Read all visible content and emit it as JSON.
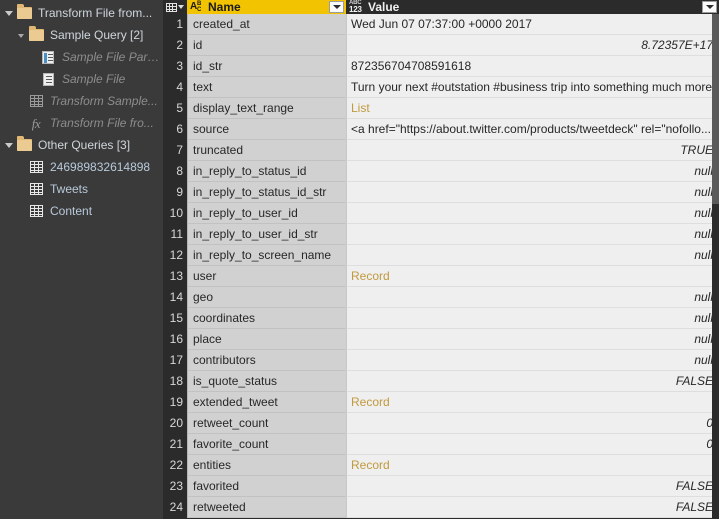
{
  "queries_pane": {
    "nodes": [
      {
        "label": "Transform File from...",
        "icon": "folder-icon",
        "depth": 0,
        "expandable": true,
        "style": "normal"
      },
      {
        "label": "Sample Query [2]",
        "icon": "folder-icon",
        "depth": 1,
        "expandable": true,
        "style": "normal"
      },
      {
        "label": "Sample File Para...",
        "icon": "parameter-icon",
        "depth": 2,
        "expandable": false,
        "style": "dim"
      },
      {
        "label": "Sample File",
        "icon": "binary-file-icon",
        "depth": 2,
        "expandable": false,
        "style": "dim"
      },
      {
        "label": "Transform Sample...",
        "icon": "table-icon",
        "depth": 1,
        "expandable": false,
        "style": "dim"
      },
      {
        "label": "Transform File fro...",
        "icon": "function-fx-icon",
        "depth": 1,
        "expandable": false,
        "style": "dim"
      },
      {
        "label": "Other Queries [3]",
        "icon": "folder-icon",
        "depth": 0,
        "expandable": true,
        "style": "normal"
      },
      {
        "label": "246989832614898",
        "icon": "table-icon",
        "depth": 1,
        "expandable": false,
        "style": "link"
      },
      {
        "label": "Tweets",
        "icon": "table-icon",
        "depth": 1,
        "expandable": false,
        "style": "link"
      },
      {
        "label": "Content",
        "icon": "table-icon",
        "depth": 1,
        "expandable": false,
        "style": "link"
      }
    ]
  },
  "grid": {
    "columns": [
      {
        "label": "Name",
        "type_icon": "abc-text-type-icon",
        "selected": true
      },
      {
        "label": "Value",
        "type_icon": "abc123-any-type-icon",
        "selected": false
      }
    ],
    "rows": [
      {
        "num": "1",
        "name": "created_at",
        "value": "Wed Jun 07 07:37:00 +0000 2017",
        "align": "left",
        "kind": "text"
      },
      {
        "num": "2",
        "name": "id",
        "value": "8.72357E+17",
        "align": "right",
        "kind": "number"
      },
      {
        "num": "3",
        "name": "id_str",
        "value": "872356704708591618",
        "align": "left",
        "kind": "text"
      },
      {
        "num": "4",
        "name": "text",
        "value": "Turn your next #outstation #business trip into something much more t...",
        "align": "left",
        "kind": "text"
      },
      {
        "num": "5",
        "name": "display_text_range",
        "value": "List",
        "align": "left",
        "kind": "link"
      },
      {
        "num": "6",
        "name": "source",
        "value": "<a href=\"https://about.twitter.com/products/tweetdeck\" rel=\"nofollo...",
        "align": "left",
        "kind": "text"
      },
      {
        "num": "7",
        "name": "truncated",
        "value": "TRUE",
        "align": "right",
        "kind": "logical"
      },
      {
        "num": "8",
        "name": "in_reply_to_status_id",
        "value": "null",
        "align": "right",
        "kind": "null"
      },
      {
        "num": "9",
        "name": "in_reply_to_status_id_str",
        "value": "null",
        "align": "right",
        "kind": "null"
      },
      {
        "num": "10",
        "name": "in_reply_to_user_id",
        "value": "null",
        "align": "right",
        "kind": "null"
      },
      {
        "num": "11",
        "name": "in_reply_to_user_id_str",
        "value": "null",
        "align": "right",
        "kind": "null"
      },
      {
        "num": "12",
        "name": "in_reply_to_screen_name",
        "value": "null",
        "align": "right",
        "kind": "null"
      },
      {
        "num": "13",
        "name": "user",
        "value": "Record",
        "align": "left",
        "kind": "link"
      },
      {
        "num": "14",
        "name": "geo",
        "value": "null",
        "align": "right",
        "kind": "null"
      },
      {
        "num": "15",
        "name": "coordinates",
        "value": "null",
        "align": "right",
        "kind": "null"
      },
      {
        "num": "16",
        "name": "place",
        "value": "null",
        "align": "right",
        "kind": "null"
      },
      {
        "num": "17",
        "name": "contributors",
        "value": "null",
        "align": "right",
        "kind": "null"
      },
      {
        "num": "18",
        "name": "is_quote_status",
        "value": "FALSE",
        "align": "right",
        "kind": "logical"
      },
      {
        "num": "19",
        "name": "extended_tweet",
        "value": "Record",
        "align": "left",
        "kind": "link"
      },
      {
        "num": "20",
        "name": "retweet_count",
        "value": "0",
        "align": "right",
        "kind": "number"
      },
      {
        "num": "21",
        "name": "favorite_count",
        "value": "0",
        "align": "right",
        "kind": "number"
      },
      {
        "num": "22",
        "name": "entities",
        "value": "Record",
        "align": "left",
        "kind": "link"
      },
      {
        "num": "23",
        "name": "favorited",
        "value": "FALSE",
        "align": "right",
        "kind": "logical"
      },
      {
        "num": "24",
        "name": "retweeted",
        "value": "FALSE",
        "align": "right",
        "kind": "logical"
      }
    ]
  },
  "colors": {
    "pane_bg": "#3a3a3a",
    "grid_bg": "#2b2b2b",
    "header_selected": "#f2c300",
    "name_cell_bg": "#d1d1d1",
    "value_cell_bg": "#efefef",
    "structured_link": "#c19a3f",
    "query_link": "#b9cadb",
    "folder": "#e0b874"
  }
}
